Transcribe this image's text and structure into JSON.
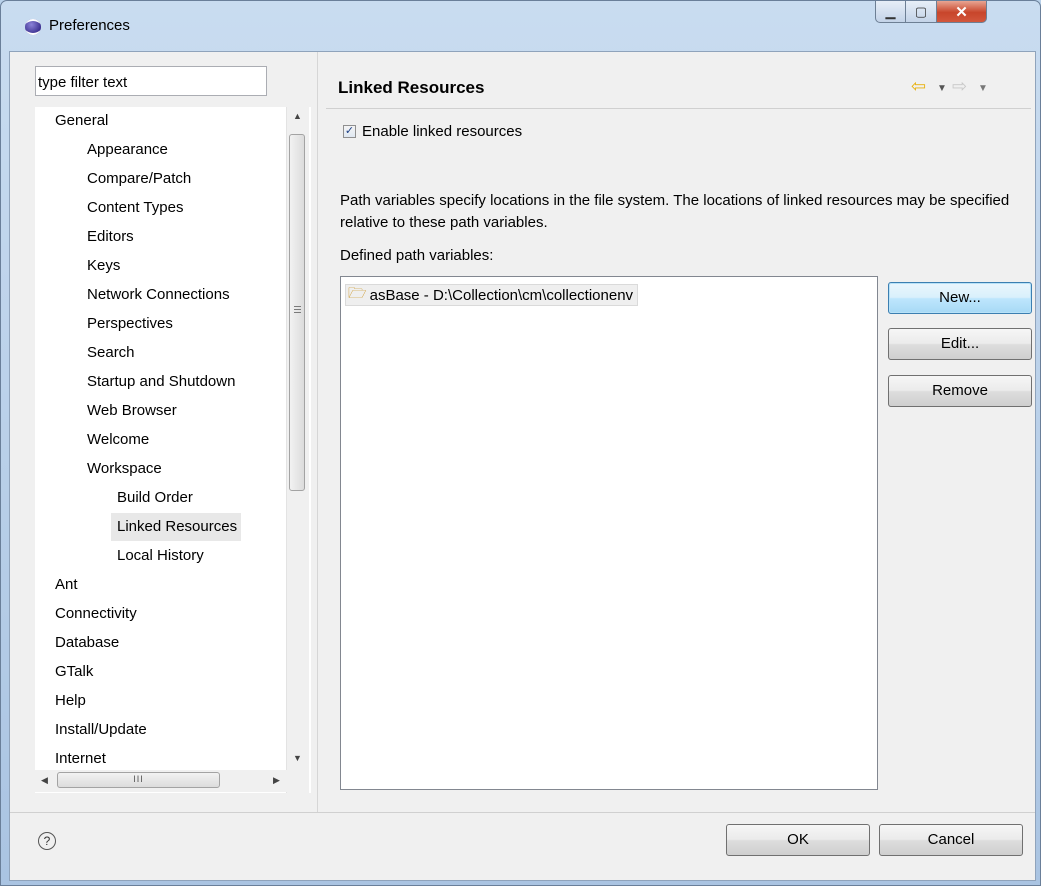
{
  "window": {
    "title": "Preferences"
  },
  "filter": {
    "placeholder": "type filter text"
  },
  "tree": {
    "items": [
      {
        "label": "General",
        "level": 1
      },
      {
        "label": "Appearance",
        "level": 2
      },
      {
        "label": "Compare/Patch",
        "level": 2
      },
      {
        "label": "Content Types",
        "level": 2
      },
      {
        "label": "Editors",
        "level": 2
      },
      {
        "label": "Keys",
        "level": 2
      },
      {
        "label": "Network Connections",
        "level": 2
      },
      {
        "label": "Perspectives",
        "level": 2
      },
      {
        "label": "Search",
        "level": 2
      },
      {
        "label": "Startup and Shutdown",
        "level": 2
      },
      {
        "label": "Web Browser",
        "level": 2
      },
      {
        "label": "Welcome",
        "level": 2
      },
      {
        "label": "Workspace",
        "level": 2
      },
      {
        "label": "Build Order",
        "level": 3
      },
      {
        "label": "Linked Resources",
        "level": 3,
        "selected": true
      },
      {
        "label": "Local History",
        "level": 3
      },
      {
        "label": "Ant",
        "level": 0
      },
      {
        "label": "Connectivity",
        "level": 0
      },
      {
        "label": "Database",
        "level": 0
      },
      {
        "label": "GTalk",
        "level": 0
      },
      {
        "label": "Help",
        "level": 0
      },
      {
        "label": "Install/Update",
        "level": 0
      },
      {
        "label": "Internet",
        "level": 0
      }
    ],
    "hscroll_grip": "III"
  },
  "page": {
    "title": "Linked Resources",
    "enable_label": "Enable linked resources",
    "enable_checked": true,
    "description": "Path variables specify locations in the file system. The locations of linked resources may be specified relative to these path variables.",
    "defined_label": "Defined path variables:",
    "variables": [
      {
        "label": "asBase - D:\\Collection\\cm\\collectionenv"
      }
    ],
    "buttons": {
      "new": "New...",
      "edit": "Edit...",
      "remove": "Remove"
    }
  },
  "footer": {
    "ok": "OK",
    "cancel": "Cancel"
  }
}
